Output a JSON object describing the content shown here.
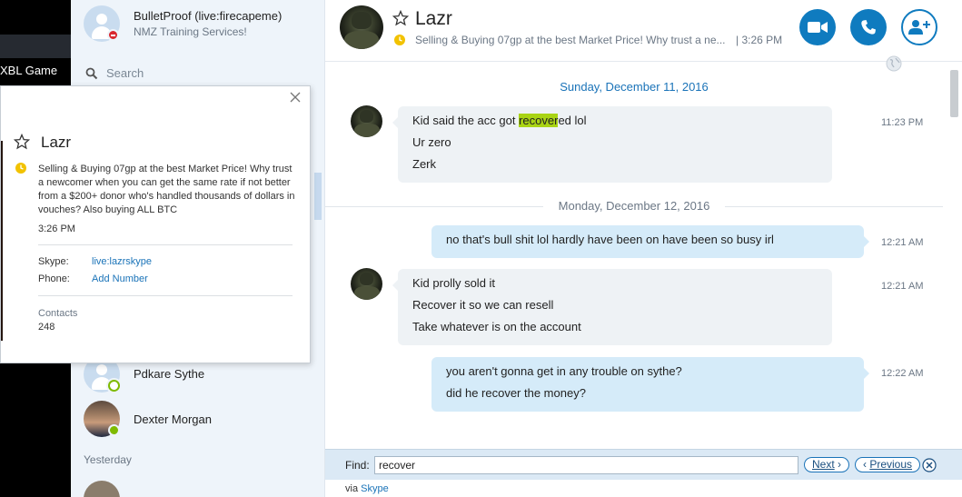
{
  "desktop": {
    "taskbar_label": "XBL Game"
  },
  "sidebar": {
    "top_contact": {
      "name": "BulletProof (live:firecapeme)",
      "mood": "NMZ Training Services!",
      "status": "busy"
    },
    "search_placeholder": "Search",
    "contacts": [
      {
        "name": "Pdkare Sythe",
        "status": "away"
      },
      {
        "name": "Dexter Morgan",
        "status": "online"
      }
    ],
    "section_label": "Yesterday"
  },
  "profile_card": {
    "name": "Lazr",
    "mood": "Selling & Buying 07gp at the best Market Price! Why trust a newcomer when you can get the same rate if not better from a $200+ donor who's handled thousands of dollars in vouches? Also buying ALL BTC",
    "time": "3:26 PM",
    "skype_label": "Skype:",
    "skype_value": "live:lazrskype",
    "phone_label": "Phone:",
    "phone_value": "Add Number",
    "contacts_label": "Contacts",
    "contacts_count": "248"
  },
  "chat": {
    "title": "Lazr",
    "mood": "Selling & Buying 07gp at the best Market Price! Why trust a ne...",
    "mood_time": "| 3:26 PM",
    "date_1": "Sunday, December 11, 2016",
    "date_2": "Monday, December 12, 2016",
    "messages": [
      {
        "from": "Lazr",
        "lines": [
          "Kid said the acc got recovered lol",
          "Ur zero",
          "Zerk"
        ],
        "time": "11:23 PM"
      },
      {
        "from": "me",
        "lines": [
          "no that's bull shit lol hardly have been on have been so busy irl"
        ],
        "time": "12:21 AM"
      },
      {
        "from": "Lazr",
        "lines": [
          "Kid prolly sold it",
          "Recover it so we can resell",
          "Take whatever is on the account"
        ],
        "time": "12:21 AM"
      },
      {
        "from": "me",
        "lines": [
          "you aren't gonna get in any trouble on sythe?",
          "did he recover the money?"
        ],
        "time": "12:22 AM"
      }
    ],
    "highlight": {
      "before": "Kid said the acc got ",
      "match": "recover",
      "after": "ed lol"
    }
  },
  "find_bar": {
    "label": "Find:",
    "query": "recover",
    "next_label": "Next",
    "previous_label": "Previous"
  },
  "footer": {
    "via_prefix": "via ",
    "via_brand": "Skype"
  },
  "colors": {
    "accent": "#0f7bbf",
    "highlight": "#a9d414",
    "busy": "#d9272e",
    "online": "#7fba00",
    "outgoing_bubble": "#d5ebf9",
    "incoming_bubble": "#eef2f5"
  },
  "icons": [
    "video-call-icon",
    "audio-call-icon",
    "add-people-icon",
    "star-icon",
    "clock-icon",
    "close-icon",
    "search-icon",
    "globe-icon"
  ]
}
